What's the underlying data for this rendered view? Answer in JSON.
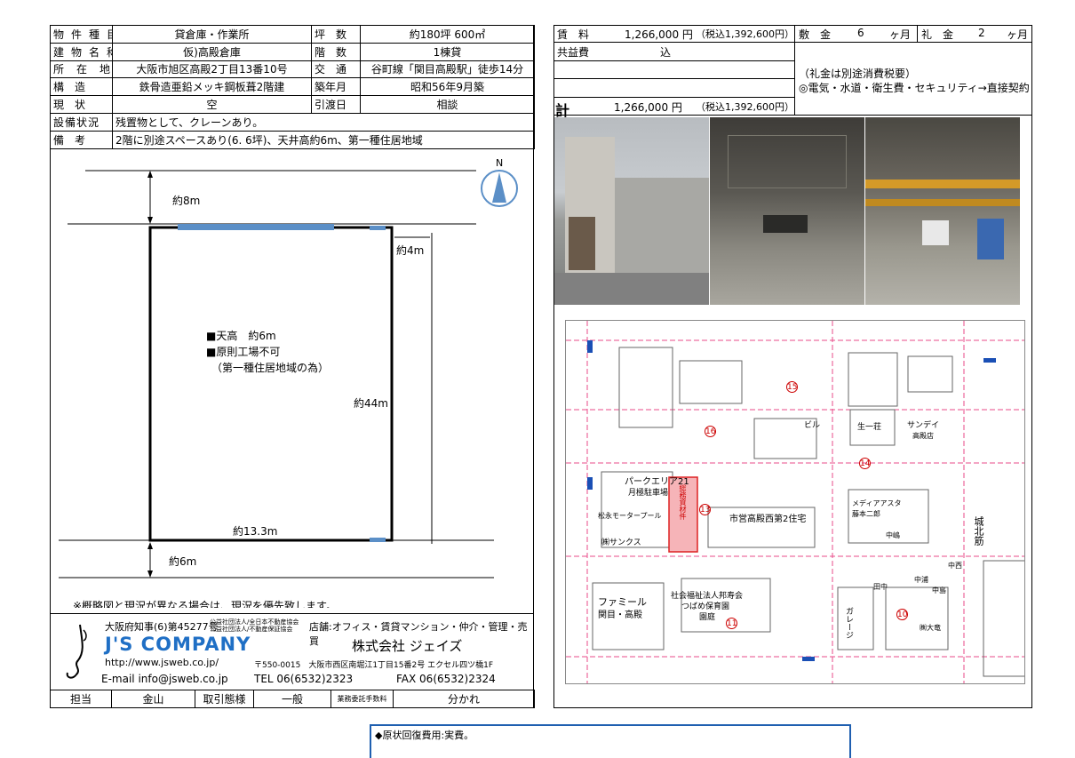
{
  "left_table": {
    "rows": [
      {
        "label1": "物件種目",
        "value1": "貸倉庫・作業所",
        "label2": "坪　数",
        "value2": "約180坪 600㎡"
      },
      {
        "label1": "建物名称",
        "value1": "仮)高殿倉庫",
        "label2": "階　数",
        "value2": "1棟貸"
      },
      {
        "label1": "所在地",
        "value1": "大阪市旭区高殿2丁目13番10号",
        "label2": "交　通",
        "value2": "谷町線「関目高殿駅」徒歩14分"
      },
      {
        "label1": "構　造",
        "value1": "鉄骨造亜鉛メッキ鋼板葺2階建",
        "label2": "築年月",
        "value2": "昭和56年9月築"
      },
      {
        "label1": "現　状",
        "value1": "空",
        "label2": "引渡日",
        "value2": "相談"
      }
    ],
    "equipment_label": "設備状況",
    "equipment_value": "残置物として、クレーンあり。",
    "notes_label": "備　考",
    "notes_value": "2階に別途スペースあり(6. 6坪)、天井高約6m、第一種住居地域"
  },
  "plan": {
    "north": "N",
    "dim_top": "約8m",
    "dim_right": "約4m",
    "dim_height": "約44m",
    "dim_width": "約13.3m",
    "dim_bottom": "約6m",
    "note1": "■天高　約6m",
    "note2": "■原則工場不可",
    "note3": "（第一種住居地域の為）",
    "disclaimer": "※概略図と現況が異なる場合は、現況を優先致します。"
  },
  "company": {
    "license": "大阪府知事(6)第45277号",
    "assoc1": "公益社団法人/全日本不動産協会",
    "assoc2": "公益社団法人/不動産保証協会",
    "store": "店舗:オフィス・賃貸マンション・仲介・管理・売買",
    "logo": "J'S COMPANY",
    "name": "株式会社 ジェイズ",
    "url": "http://www.jsweb.co.jp/",
    "address": "〒550-0015　大阪市西区南堀江1丁目15番2号 エクセル四ツ橋1F",
    "email": "E-mail info@jsweb.co.jp",
    "tel": "TEL 06(6532)2323",
    "fax": "FAX 06(6532)2324"
  },
  "footer": {
    "c1": "担当",
    "c2": "金山",
    "c3": "取引態様",
    "c4": "一般",
    "c5": "業務委託手数料",
    "c6": "分かれ"
  },
  "right_table": {
    "rent_label": "賃　料",
    "rent_value": "1,266,000 円",
    "rent_tax": "（税込1,392,600円）",
    "deposit_label": "敷　金",
    "deposit_value": "6",
    "deposit_unit": "ヶ月",
    "key_label": "礼　金",
    "key_value": "2",
    "key_unit": "ヶ月",
    "common_label": "共益費",
    "common_value": "込",
    "total_label": "計",
    "total_value": "1,266,000 円",
    "total_tax": "（税込1,392,600円）",
    "note1": "（礼金は別途消費税要）",
    "note2": "◎電気・水道・衛生費・セキュリティ→直接契約"
  },
  "map": {
    "labels": [
      "パークエリア21",
      "月極駐車場",
      "総務資材件",
      "松永モータープール",
      "㈱サンクス",
      "市営高殿西第2住宅",
      "ファミール",
      "関目・高殿",
      "社会福祉法人邦寿会",
      "つばめ保育園",
      "園庭",
      "ガレージ",
      "メディアアスタ",
      "藤本二郎",
      "中嶋",
      "生一荘",
      "サンデイ",
      "高殿店",
      "城北筋",
      "ビル",
      "中島",
      "中西",
      "田中",
      "中浦",
      "㈱大竜"
    ],
    "numbers": [
      "15",
      "16",
      "13",
      "14",
      "11",
      "10"
    ]
  },
  "bottom_box": {
    "text": "◆原状回復費用:実費。"
  }
}
